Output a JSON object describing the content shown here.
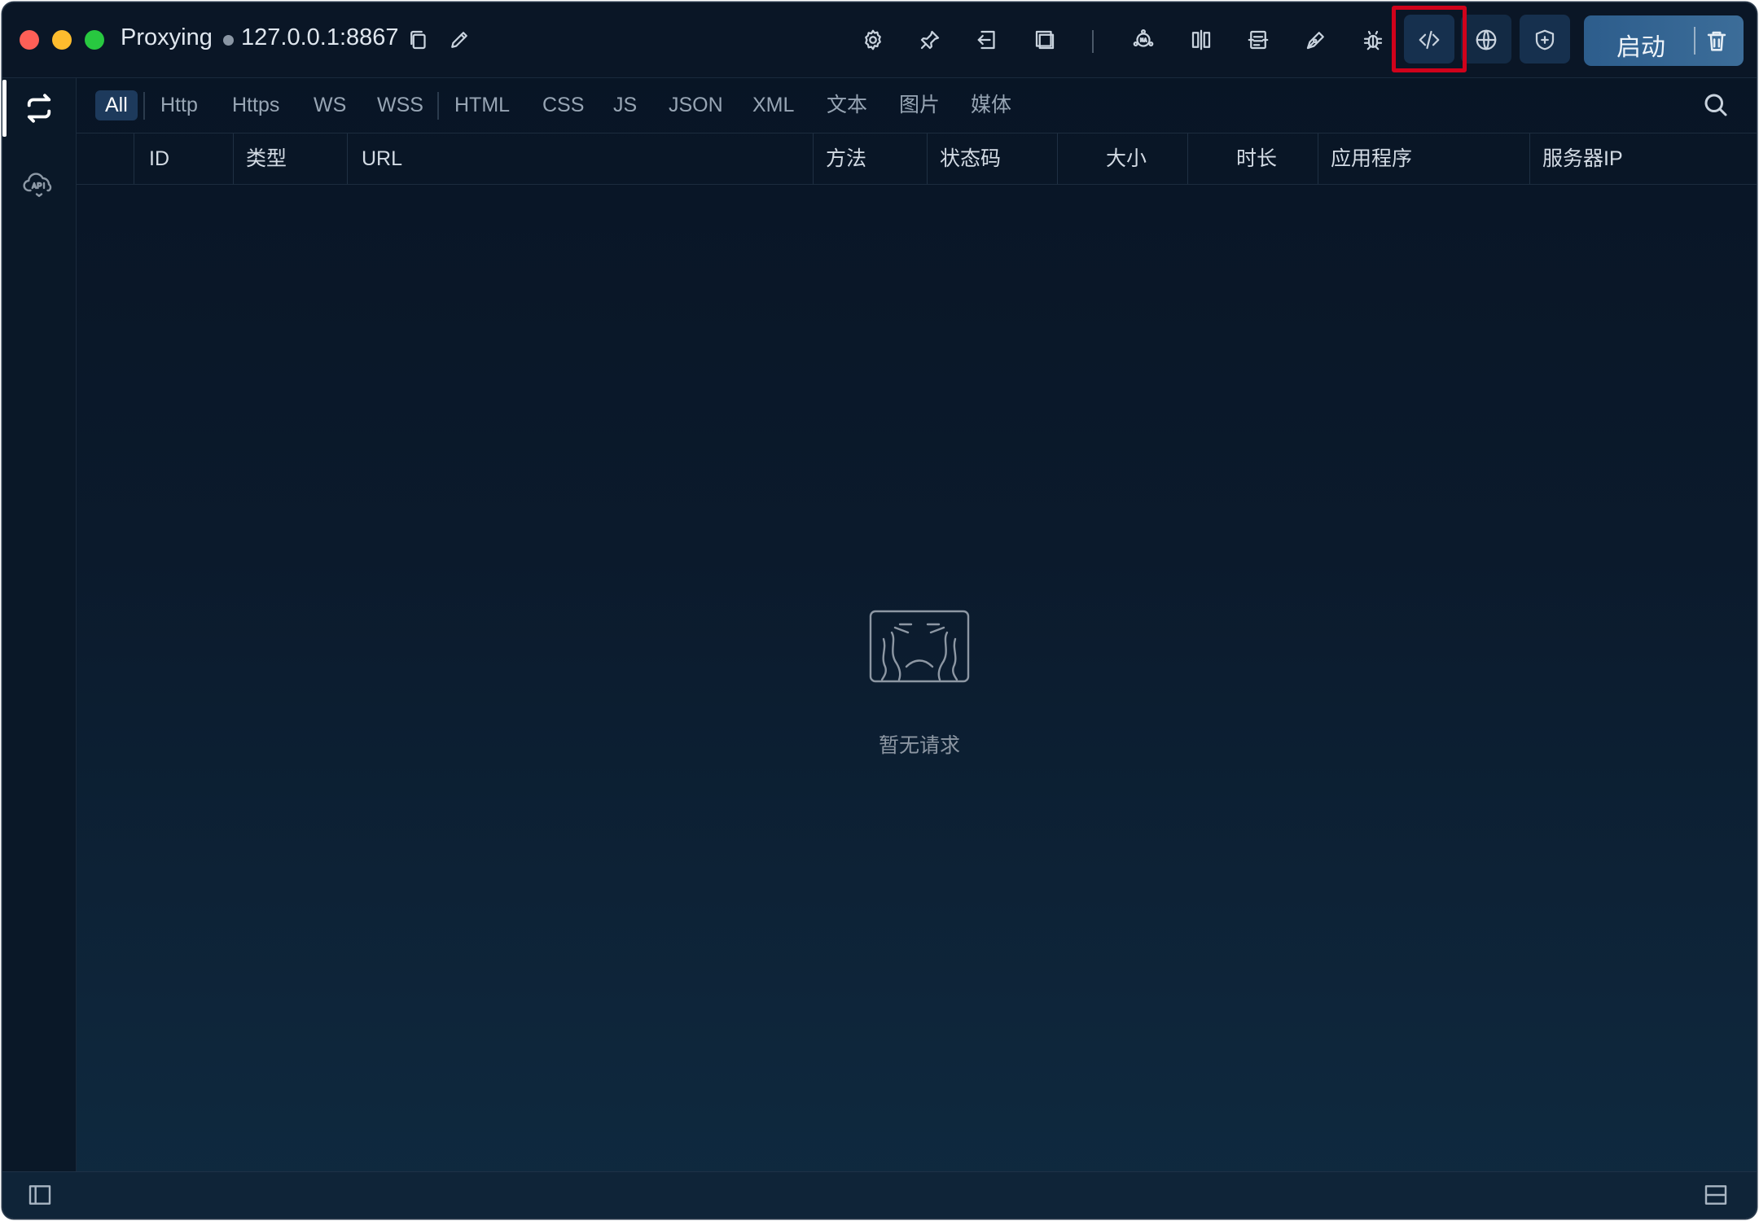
{
  "titlebar": {
    "title": "Proxying",
    "address": "127.0.0.1:8867",
    "status_color": "#8a96a4",
    "icons": {
      "copy": "copy-icon",
      "edit": "pencil-icon",
      "settings": "gear-icon",
      "pin": "pin-icon",
      "import": "import-icon",
      "window": "window-icon",
      "nat": "nat-icon",
      "split": "split-view-icon",
      "script": "script-icon",
      "pen": "pen-icon",
      "debug": "bug-icon",
      "code": "code-icon",
      "globe": "globe-icon",
      "shield": "shield-icon",
      "trash": "trash-icon"
    },
    "start_label": "启动",
    "active_tool": "code-icon",
    "highlight_color": "#d0021b"
  },
  "sidebar": {
    "items": [
      {
        "icon": "refresh-icon",
        "active": true
      },
      {
        "icon": "api-cloud-icon",
        "active": false
      }
    ]
  },
  "filters": {
    "items": [
      "All",
      "Http",
      "Https",
      "WS",
      "WSS",
      "HTML",
      "CSS",
      "JS",
      "JSON",
      "XML",
      "文本",
      "图片",
      "媒体"
    ],
    "active": "All"
  },
  "table": {
    "columns": [
      "ID",
      "类型",
      "URL",
      "方法",
      "状态码",
      "大小",
      "时长",
      "应用程序",
      "服务器IP"
    ]
  },
  "empty_state": {
    "text": "暂无请求",
    "icon": "empty-sad-icon"
  },
  "footer": {
    "left_icon": "sidebar-toggle-icon",
    "right_icon": "panel-toggle-icon"
  }
}
